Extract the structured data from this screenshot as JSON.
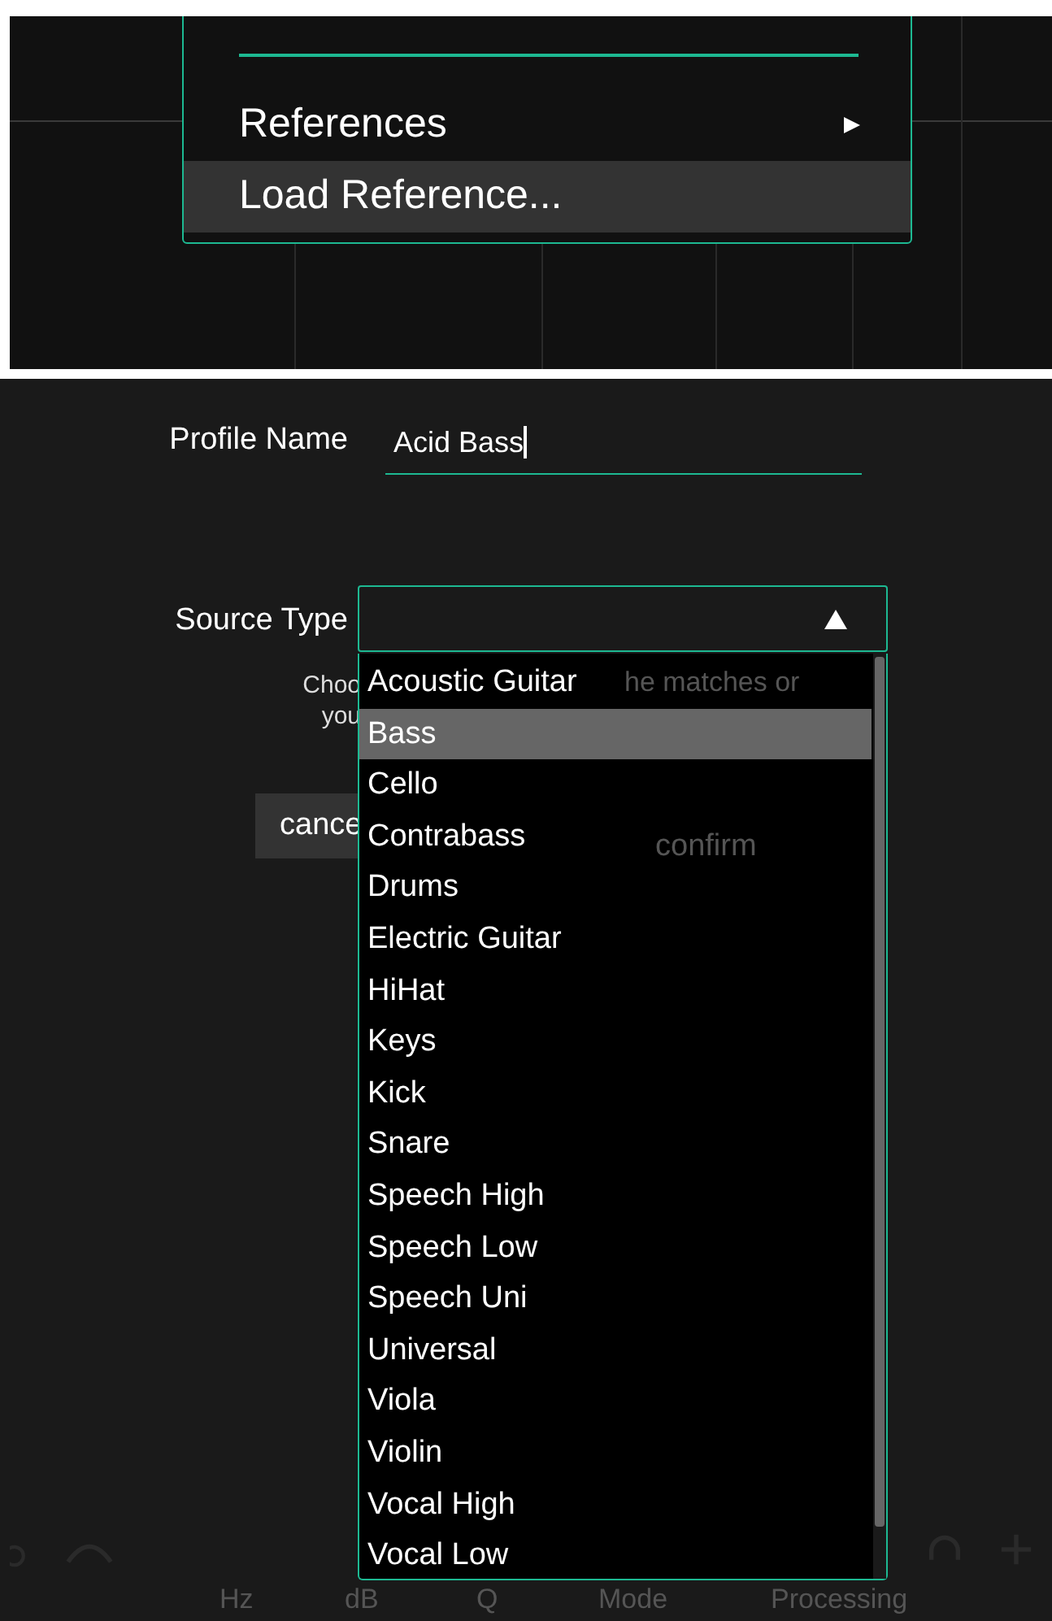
{
  "menu": {
    "items": [
      {
        "label": "References",
        "submenu": true,
        "selected": false
      },
      {
        "label": "Load Reference...",
        "submenu": false,
        "selected": true
      }
    ]
  },
  "profile_name": {
    "label": "Profile Name",
    "value": "Acid Bass"
  },
  "source_type": {
    "label": "Source Type",
    "expanded": true,
    "options": [
      {
        "label": "Acoustic Guitar",
        "selected": false
      },
      {
        "label": "Bass",
        "selected": true
      },
      {
        "label": "Cello",
        "selected": false
      },
      {
        "label": "Contrabass",
        "selected": false
      },
      {
        "label": "Drums",
        "selected": false
      },
      {
        "label": "Electric Guitar",
        "selected": false
      },
      {
        "label": "HiHat",
        "selected": false
      },
      {
        "label": "Keys",
        "selected": false
      },
      {
        "label": "Kick",
        "selected": false
      },
      {
        "label": "Snare",
        "selected": false
      },
      {
        "label": "Speech High",
        "selected": false
      },
      {
        "label": "Speech Low",
        "selected": false
      },
      {
        "label": "Speech Uni",
        "selected": false
      },
      {
        "label": "Universal",
        "selected": false
      },
      {
        "label": "Viola",
        "selected": false
      },
      {
        "label": "Violin",
        "selected": false
      },
      {
        "label": "Vocal High",
        "selected": false
      },
      {
        "label": "Vocal Low",
        "selected": false
      }
    ]
  },
  "hint": {
    "line_1_start": "Choo",
    "line_1_end": "he matches or",
    "line_2_start": "you"
  },
  "buttons": {
    "cancel": "cance",
    "confirm": "confirm"
  },
  "bottom_bar": {
    "labels": [
      "Hz",
      "dB",
      "Q",
      "Mode",
      "Processing"
    ]
  }
}
